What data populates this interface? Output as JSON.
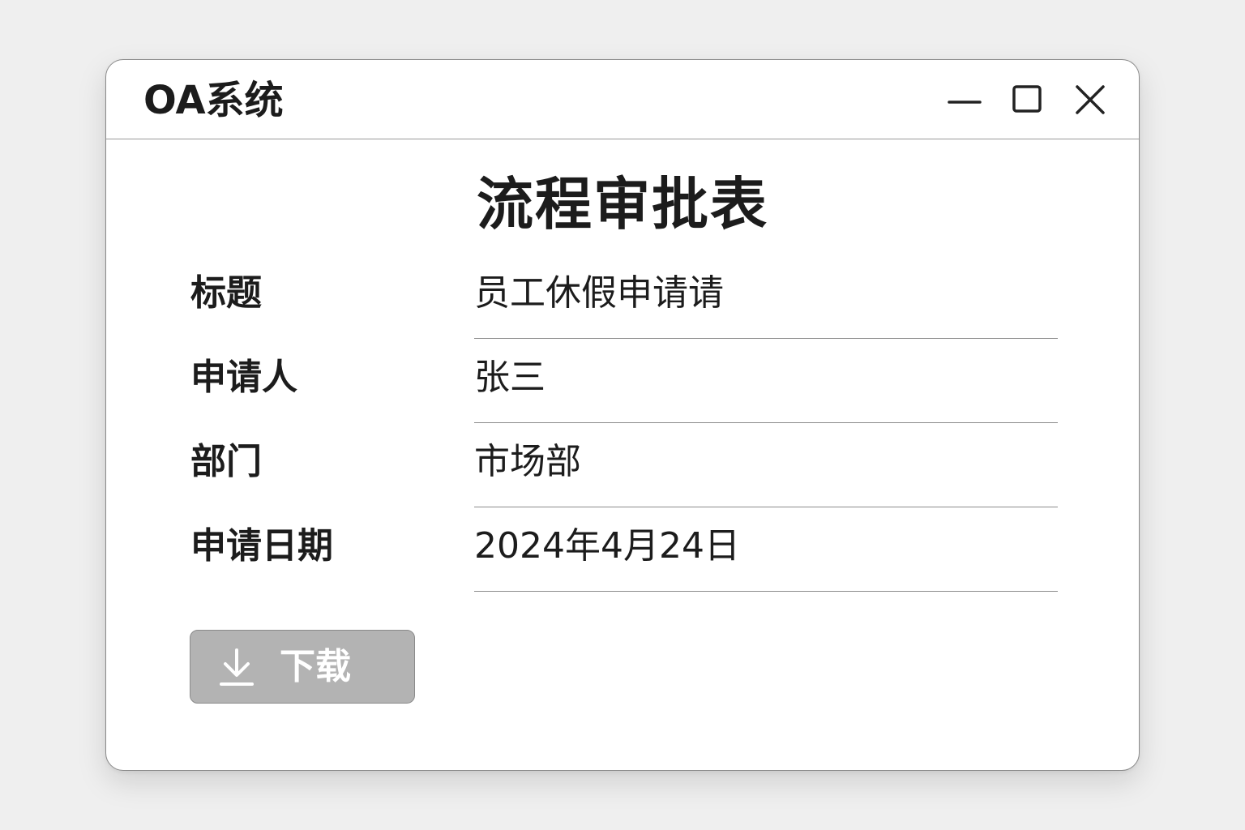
{
  "window": {
    "title": "OA系统",
    "controls": {
      "minimize_icon": "minimize-icon",
      "maximize_icon": "maximize-icon",
      "close_icon": "close-icon"
    }
  },
  "form": {
    "title": "流程审批表",
    "fields": [
      {
        "label": "标题",
        "value": "员工休假申请请"
      },
      {
        "label": "申请人",
        "value": "张三"
      },
      {
        "label": "部门",
        "value": "市场部"
      },
      {
        "label": "申请日期",
        "value": "2024年4月24日"
      }
    ]
  },
  "actions": {
    "download": {
      "label": "下载",
      "icon": "download-icon",
      "state": "disabled"
    }
  },
  "colors": {
    "background": "#efefef",
    "window": "#ffffff",
    "text": "#1c1c1c",
    "button_disabled": "#b3b3b3"
  }
}
